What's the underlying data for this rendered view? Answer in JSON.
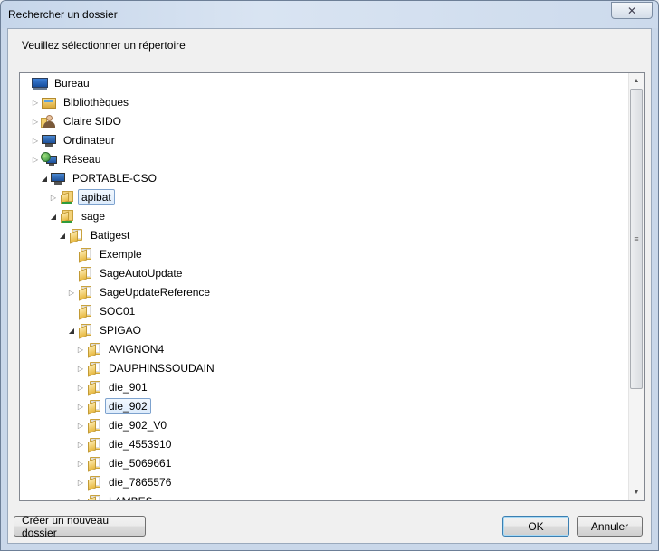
{
  "window": {
    "title": "Rechercher un dossier",
    "close_label": "✕"
  },
  "prompt": "Veuillez sélectionner un répertoire",
  "tree": {
    "items": [
      {
        "label": "Bureau",
        "icon": "desktop-icon",
        "expander": "none",
        "level": 0
      },
      {
        "label": "Bibliothèques",
        "icon": "library-icon",
        "expander": "collapsed",
        "level": 1
      },
      {
        "label": "Claire SIDO",
        "icon": "user-folder-icon",
        "expander": "collapsed",
        "level": 1
      },
      {
        "label": "Ordinateur",
        "icon": "computer-icon",
        "expander": "collapsed",
        "level": 1
      },
      {
        "label": "Réseau",
        "icon": "network-icon",
        "expander": "collapsed",
        "level": 1
      },
      {
        "label": "PORTABLE-CSO",
        "icon": "computer-icon",
        "expander": "expanded",
        "level": 2
      },
      {
        "label": "apibat",
        "icon": "shared-folder-icon",
        "expander": "collapsed",
        "level": 3
      },
      {
        "label": "sage",
        "icon": "shared-folder-icon",
        "expander": "expanded",
        "level": 3
      },
      {
        "label": "Batigest",
        "icon": "folder-icon",
        "expander": "expanded",
        "level": 4
      },
      {
        "label": "Exemple",
        "icon": "folder-icon",
        "expander": "none",
        "level": 5
      },
      {
        "label": "SageAutoUpdate",
        "icon": "folder-icon",
        "expander": "none",
        "level": 5
      },
      {
        "label": "SageUpdateReference",
        "icon": "folder-icon",
        "expander": "collapsed",
        "level": 5
      },
      {
        "label": "SOC01",
        "icon": "folder-icon",
        "expander": "none",
        "level": 5
      },
      {
        "label": "SPIGAO",
        "icon": "folder-icon",
        "expander": "expanded",
        "level": 5
      },
      {
        "label": "AVIGNON4",
        "icon": "folder-icon",
        "expander": "collapsed",
        "level": 6
      },
      {
        "label": "DAUPHINSSOUDAIN",
        "icon": "folder-icon",
        "expander": "collapsed",
        "level": 6
      },
      {
        "label": "die_901",
        "icon": "folder-icon",
        "expander": "collapsed",
        "level": 6
      },
      {
        "label": "die_902",
        "icon": "folder-icon",
        "expander": "collapsed",
        "level": 6
      },
      {
        "label": "die_902_V0",
        "icon": "folder-icon",
        "expander": "collapsed",
        "level": 6
      },
      {
        "label": "die_4553910",
        "icon": "folder-icon",
        "expander": "collapsed",
        "level": 6
      },
      {
        "label": "die_5069661",
        "icon": "folder-icon",
        "expander": "collapsed",
        "level": 6
      },
      {
        "label": "die_7865576",
        "icon": "folder-icon",
        "expander": "collapsed",
        "level": 6
      },
      {
        "label": "LAMBES",
        "icon": "folder-icon",
        "expander": "collapsed",
        "level": 6
      }
    ],
    "selected": "die_902",
    "hover": "apibat"
  },
  "buttons": {
    "new_folder": "Créer un nouveau dossier",
    "ok": "OK",
    "cancel": "Annuler"
  },
  "colors": {
    "selection_border": "#7da2ce",
    "default_button_border": "#3c7fb1"
  }
}
